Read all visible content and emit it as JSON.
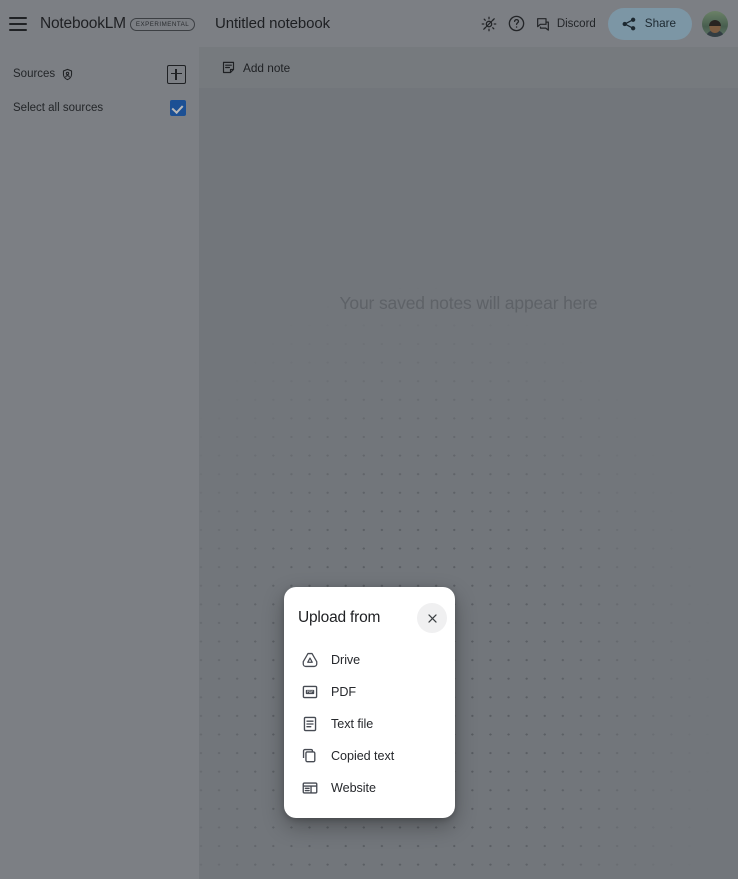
{
  "sidebar": {
    "brand": "NotebookLM",
    "badge": "EXPERIMENTAL",
    "menu_icon": "hamburger-icon",
    "sources": {
      "label": "Sources",
      "shield_icon": "shield-person-icon",
      "add_icon": "add-box-icon"
    },
    "select_all": {
      "label": "Select all sources",
      "checked": true,
      "accent": "#1b66c9"
    }
  },
  "topbar": {
    "notebook_title": "Untitled notebook",
    "brightness_icon": "brightness-off-icon",
    "help_icon": "help-circle-icon",
    "discord_label": "Discord",
    "discord_icon": "chat-bubble-icon",
    "share_label": "Share",
    "share_icon": "share-nodes-icon",
    "share_bg": "#a9cde2",
    "avatar_icon": "user-avatar"
  },
  "actionbar": {
    "add_note_label": "Add note",
    "add_note_icon": "note-add-icon"
  },
  "canvas": {
    "empty_state_text": "Your saved notes will appear here",
    "background": "#9a9ea4",
    "dot_color": "#6c7076"
  },
  "dialog": {
    "title": "Upload from",
    "close_icon": "close-icon",
    "items": [
      {
        "label": "Drive",
        "icon": "google-drive-icon"
      },
      {
        "label": "PDF",
        "icon": "pdf-file-icon"
      },
      {
        "label": "Text file",
        "icon": "text-file-icon"
      },
      {
        "label": "Copied text",
        "icon": "copy-icon"
      },
      {
        "label": "Website",
        "icon": "website-icon"
      }
    ]
  }
}
